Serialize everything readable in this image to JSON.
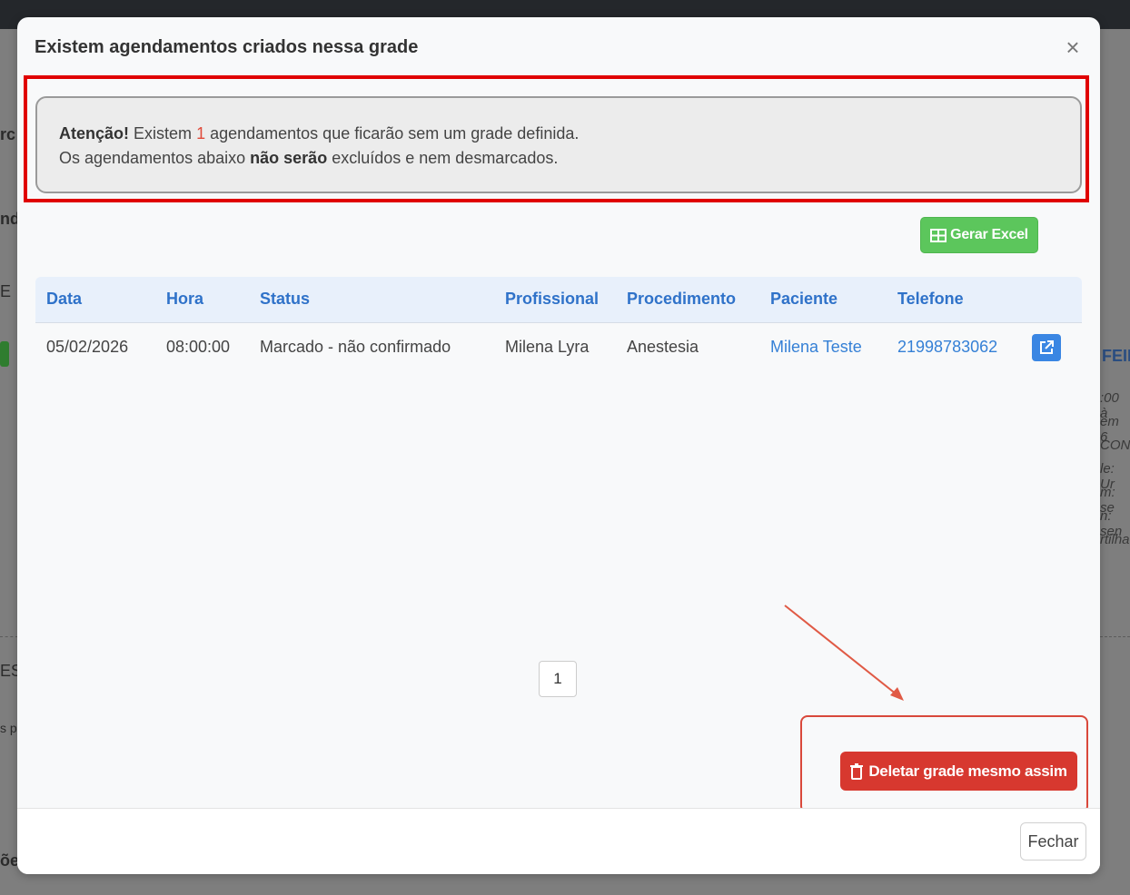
{
  "modal": {
    "title": "Existem agendamentos criados nessa grade",
    "close_symbol": "×"
  },
  "alert": {
    "strong_prefix": "Atenção!",
    "text_before_count": "Existem",
    "count": "1",
    "text_after_count": "agendamentos que ficarão sem um grade definida.",
    "line2_before": "Os agendamentos abaixo",
    "line2_strong": "não serão",
    "line2_after": "excluídos e nem desmarcados."
  },
  "toolbar": {
    "excel_label": "Gerar Excel",
    "excel_icon": "table-icon"
  },
  "table": {
    "headers": [
      "Data",
      "Hora",
      "Status",
      "Profissional",
      "Procedimento",
      "Paciente",
      "Telefone"
    ],
    "rows": [
      {
        "data": "05/02/2026",
        "hora": "08:00:00",
        "status": "Marcado - não confirmado",
        "profissional": "Milena Lyra",
        "procedimento": "Anestesia",
        "paciente": "Milena Teste",
        "telefone": "21998783062",
        "action_icon": "external-link-icon"
      }
    ]
  },
  "pagination": {
    "current_page": "1"
  },
  "actions": {
    "delete_label": "Deletar grade mesmo assim",
    "delete_icon": "trash-icon",
    "close_label": "Fechar"
  },
  "background": {
    "left_fragments": [
      "rc",
      "nd",
      "E",
      "ES",
      "s p",
      "õe"
    ],
    "right_header_fragment": "FEIR",
    "right_fragments": [
      ":00 à",
      "em 6",
      "CONS",
      "le: Ur",
      "m: se",
      "n: sen",
      "rtilha"
    ]
  },
  "colors": {
    "accent_blue": "#2f72c9",
    "success_green": "#5cc65c",
    "danger_red": "#d7382f",
    "highlight_red": "#e00000"
  }
}
